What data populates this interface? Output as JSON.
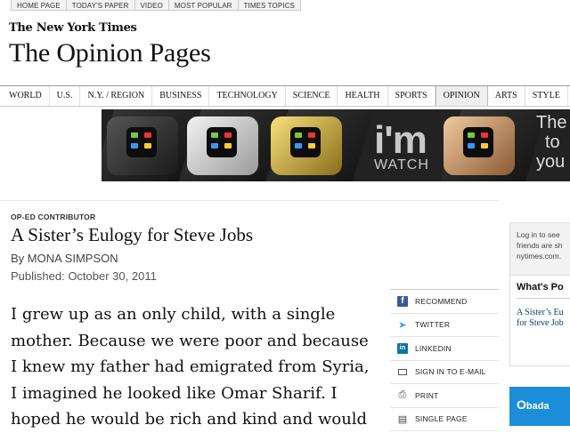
{
  "top_nav": [
    "HOME PAGE",
    "TODAY'S PAPER",
    "VIDEO",
    "MOST POPULAR",
    "TIMES TOPICS"
  ],
  "masthead": {
    "logo": "The New York Times",
    "section_title": "The Opinion Pages"
  },
  "sections": [
    "WORLD",
    "U.S.",
    "N.Y. / REGION",
    "BUSINESS",
    "TECHNOLOGY",
    "SCIENCE",
    "HEALTH",
    "SPORTS",
    "OPINION",
    "ARTS",
    "STYLE"
  ],
  "active_section": "OPINION",
  "ad": {
    "brand_big": "i'm",
    "brand_small": "WATCH",
    "side_text": [
      "The",
      "to",
      "you"
    ]
  },
  "article": {
    "kicker": "OP-ED CONTRIBUTOR",
    "headline": "A Sister’s Eulogy for Steve Jobs",
    "byline": "By MONA SIMPSON",
    "published": "Published: October 30, 2011",
    "lines": [
      "I grew up as an only child, with a single",
      "mother. Because we were poor and because",
      "I knew my father had emigrated from Syria,",
      "I imagined he looked like Omar Sharif. I",
      "hoped he would be rich and kind and would"
    ]
  },
  "tools": [
    {
      "label": "RECOMMEND",
      "icon": "facebook-icon"
    },
    {
      "label": "TWITTER",
      "icon": "twitter-icon"
    },
    {
      "label": "LINKEDIN",
      "icon": "linkedin-icon"
    },
    {
      "label": "SIGN IN TO E-MAIL",
      "icon": "mail-icon"
    },
    {
      "label": "PRINT",
      "icon": "print-icon"
    },
    {
      "label": "SINGLE PAGE",
      "icon": "page-icon"
    }
  ],
  "sidebar": {
    "login_lines": [
      "Log in to see",
      "friends are sh",
      "nytimes.com."
    ],
    "whats_popular": "What's Po",
    "popular_links": [
      "A Sister’s Eu",
      "for Steve Job"
    ],
    "ad_text": "bada"
  }
}
